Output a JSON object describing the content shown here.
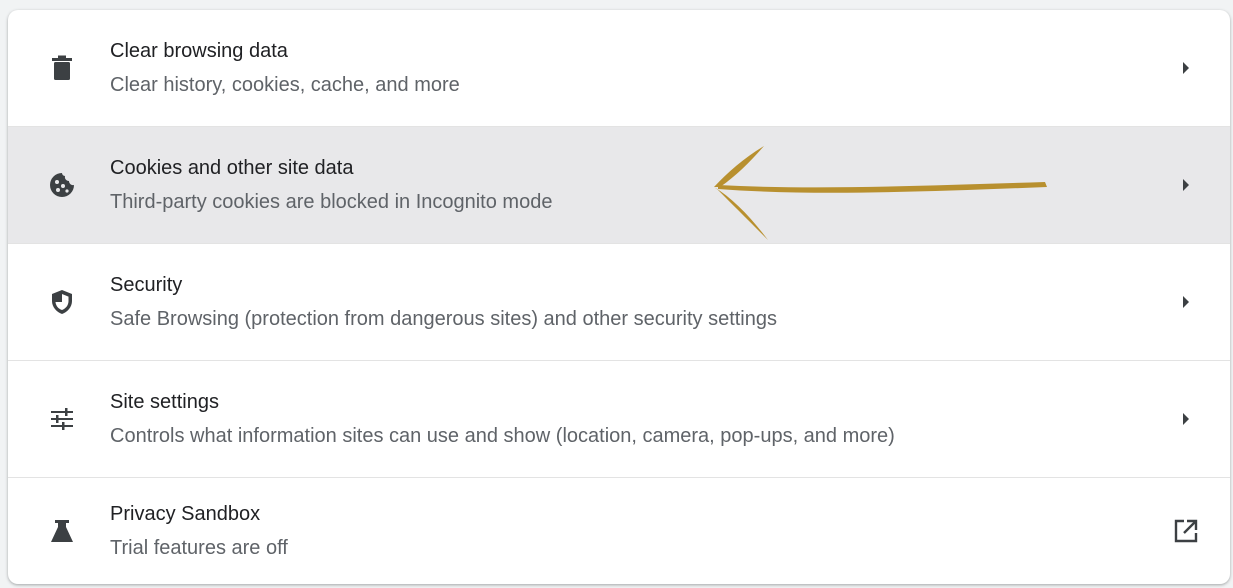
{
  "rows": [
    {
      "title": "Clear browsing data",
      "subtitle": "Clear history, cookies, cache, and more",
      "icon": "trash-icon",
      "action_icon": "chevron-right-icon"
    },
    {
      "title": "Cookies and other site data",
      "subtitle": "Third-party cookies are blocked in Incognito mode",
      "icon": "cookie-icon",
      "action_icon": "chevron-right-icon",
      "highlighted": true
    },
    {
      "title": "Security",
      "subtitle": "Safe Browsing (protection from dangerous sites) and other security settings",
      "icon": "shield-icon",
      "action_icon": "chevron-right-icon"
    },
    {
      "title": "Site settings",
      "subtitle": "Controls what information sites can use and show (location, camera, pop-ups, and more)",
      "icon": "tune-icon",
      "action_icon": "chevron-right-icon"
    },
    {
      "title": "Privacy Sandbox",
      "subtitle": "Trial features are off",
      "icon": "flask-icon",
      "action_icon": "open-external-icon"
    }
  ],
  "colors": {
    "highlight_bg": "#e8e8ea",
    "annotation_arrow": "#b8902f",
    "icon": "#3c4043"
  }
}
